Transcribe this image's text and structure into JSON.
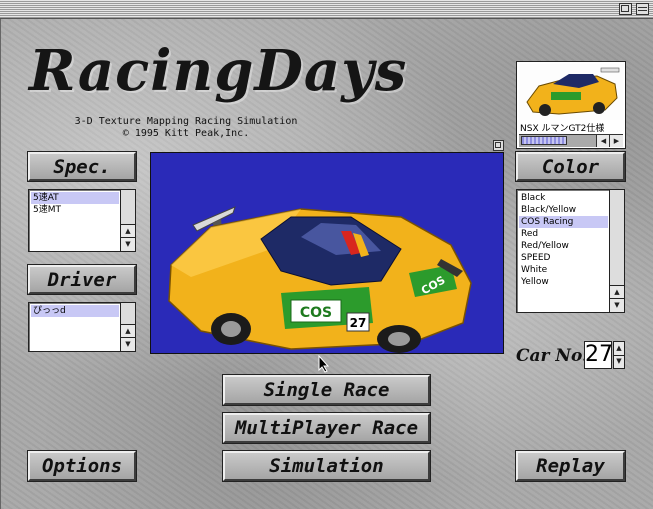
{
  "app": {
    "logo_text": "RacingDays",
    "subtitle_line1": "3-D Texture Mapping Racing Simulation",
    "subtitle_line2": "© 1995 Kitt Peak,Inc."
  },
  "thumbnail": {
    "caption": "NSX ルマンGT2仕様"
  },
  "spec": {
    "button_label": "Spec.",
    "items": [
      "5速AT",
      "5速MT"
    ],
    "selected_index": 0
  },
  "driver": {
    "button_label": "Driver",
    "items": [
      "ぴっっd"
    ],
    "selected_index": 0
  },
  "color": {
    "button_label": "Color",
    "items": [
      "Black",
      "Black/Yellow",
      "COS Racing",
      "Red",
      "Red/Yellow",
      "SPEED",
      "White",
      "Yellow"
    ],
    "selected_index": 2
  },
  "car": {
    "number_label": "Car No.",
    "number": "27",
    "livery_text": "COS",
    "decal_number": "27",
    "colors": {
      "body": "#f2b21b",
      "stripe": "#2c9b2c",
      "roof": "#1e2a66",
      "background": "#2a2ab8"
    }
  },
  "buttons": {
    "single_race": "Single Race",
    "multiplayer_race": "MultiPlayer Race",
    "simulation": "Simulation",
    "options": "Options",
    "replay": "Replay"
  }
}
